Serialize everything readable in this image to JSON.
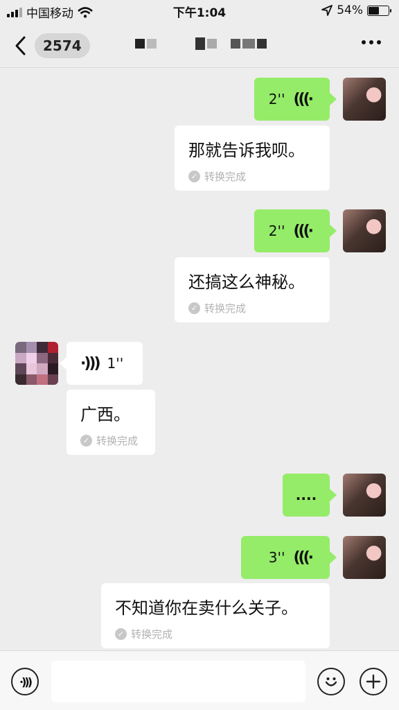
{
  "status_bar": {
    "carrier": "中国移动",
    "time": "下午1:04",
    "battery": "54%",
    "battery_level": 0.54
  },
  "nav": {
    "unread_count": "2574"
  },
  "messages": [
    {
      "duration": "2''",
      "transcript": "那就告诉我呗。",
      "status": "转换完成"
    },
    {
      "duration": "2''",
      "transcript": "还搞这么神秘。",
      "status": "转换完成"
    },
    {
      "duration": "1''",
      "transcript": "广西。",
      "status": "转换完成"
    },
    {
      "text": "...."
    },
    {
      "duration": "3''",
      "transcript": "不知道你在卖什么关子。",
      "status": "转换完成"
    }
  ],
  "icons": {
    "back": "chevron-left-icon",
    "more": "more-icon",
    "voice_toggle": "voice-icon",
    "emoji": "emoji-icon",
    "plus": "plus-icon"
  },
  "colors": {
    "outgoing_bubble": "#95ec69",
    "incoming_bubble": "#ffffff",
    "background": "#ededed"
  }
}
